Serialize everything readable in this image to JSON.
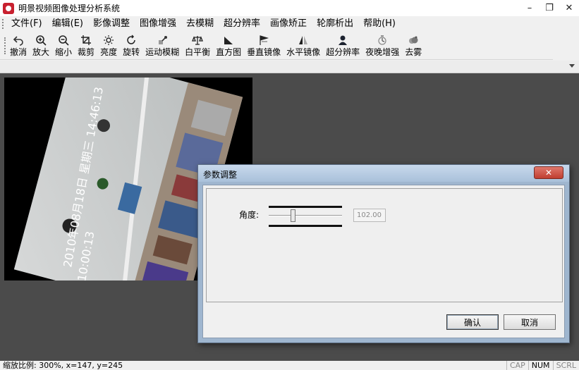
{
  "window": {
    "title": "明景视频图像处理分析系统",
    "minimize": "–",
    "maximize": "❐",
    "close": "✕"
  },
  "menu": [
    "文件(F)",
    "编辑(E)",
    "影像调整",
    "图像增强",
    "去模糊",
    "超分辨率",
    "画像矫正",
    "轮廓析出",
    "帮助(H)"
  ],
  "toolbar": [
    {
      "label": "撤消",
      "icon": "undo-icon"
    },
    {
      "label": "放大",
      "icon": "zoom-in-icon"
    },
    {
      "label": "缩小",
      "icon": "zoom-out-icon"
    },
    {
      "label": "裁剪",
      "icon": "crop-icon"
    },
    {
      "label": "亮度",
      "icon": "brightness-icon"
    },
    {
      "label": "旋转",
      "icon": "rotate-icon"
    },
    {
      "label": "运动模糊",
      "icon": "motion-blur-icon"
    },
    {
      "label": "白平衡",
      "icon": "white-balance-icon"
    },
    {
      "label": "直方图",
      "icon": "histogram-icon"
    },
    {
      "label": "垂直镜像",
      "icon": "vertical-mirror-icon"
    },
    {
      "label": "水平镜像",
      "icon": "horizontal-mirror-icon"
    },
    {
      "label": "超分辨率",
      "icon": "super-resolution-icon"
    },
    {
      "label": "夜晚增强",
      "icon": "night-enhance-icon"
    },
    {
      "label": "去雾",
      "icon": "dehaze-icon"
    }
  ],
  "image": {
    "timestamp": "2010年08月18日 星期三 14:46:13",
    "time_short": "10:00:13"
  },
  "dialog": {
    "title": "参数调整",
    "close": "✕",
    "angle_label": "角度:",
    "angle_value": "102.00",
    "slider_fraction": 0.32,
    "ok_label": "确认",
    "cancel_label": "取消"
  },
  "status": {
    "text": "缩放比例: 300%,  x=147, y=245",
    "keys": [
      {
        "label": "CAP",
        "on": false
      },
      {
        "label": "NUM",
        "on": true
      },
      {
        "label": "SCRL",
        "on": false
      }
    ]
  }
}
